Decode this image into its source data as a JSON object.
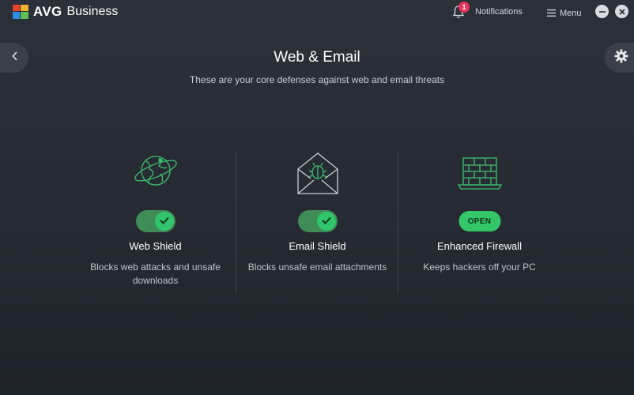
{
  "app": {
    "brand": "AVG",
    "product": "Business"
  },
  "header": {
    "notifications_label": "Notifications",
    "notifications_count": "1",
    "menu_label": "Menu"
  },
  "page": {
    "title": "Web & Email",
    "subtitle": "These are your core defenses against web and email threats"
  },
  "cards": [
    {
      "title": "Web Shield",
      "description": "Blocks web attacks and unsafe downloads",
      "enabled": true,
      "icon": "globe-shield-icon"
    },
    {
      "title": "Email Shield",
      "description": "Blocks unsafe email attachments",
      "enabled": true,
      "icon": "envelope-bug-icon"
    },
    {
      "title": "Enhanced Firewall",
      "description": "Keeps hackers off your PC",
      "action_label": "OPEN",
      "icon": "firewall-laptop-icon"
    }
  ],
  "colors": {
    "accent": "#34c76a",
    "badge": "#e8345a",
    "background": "#2b3039"
  }
}
